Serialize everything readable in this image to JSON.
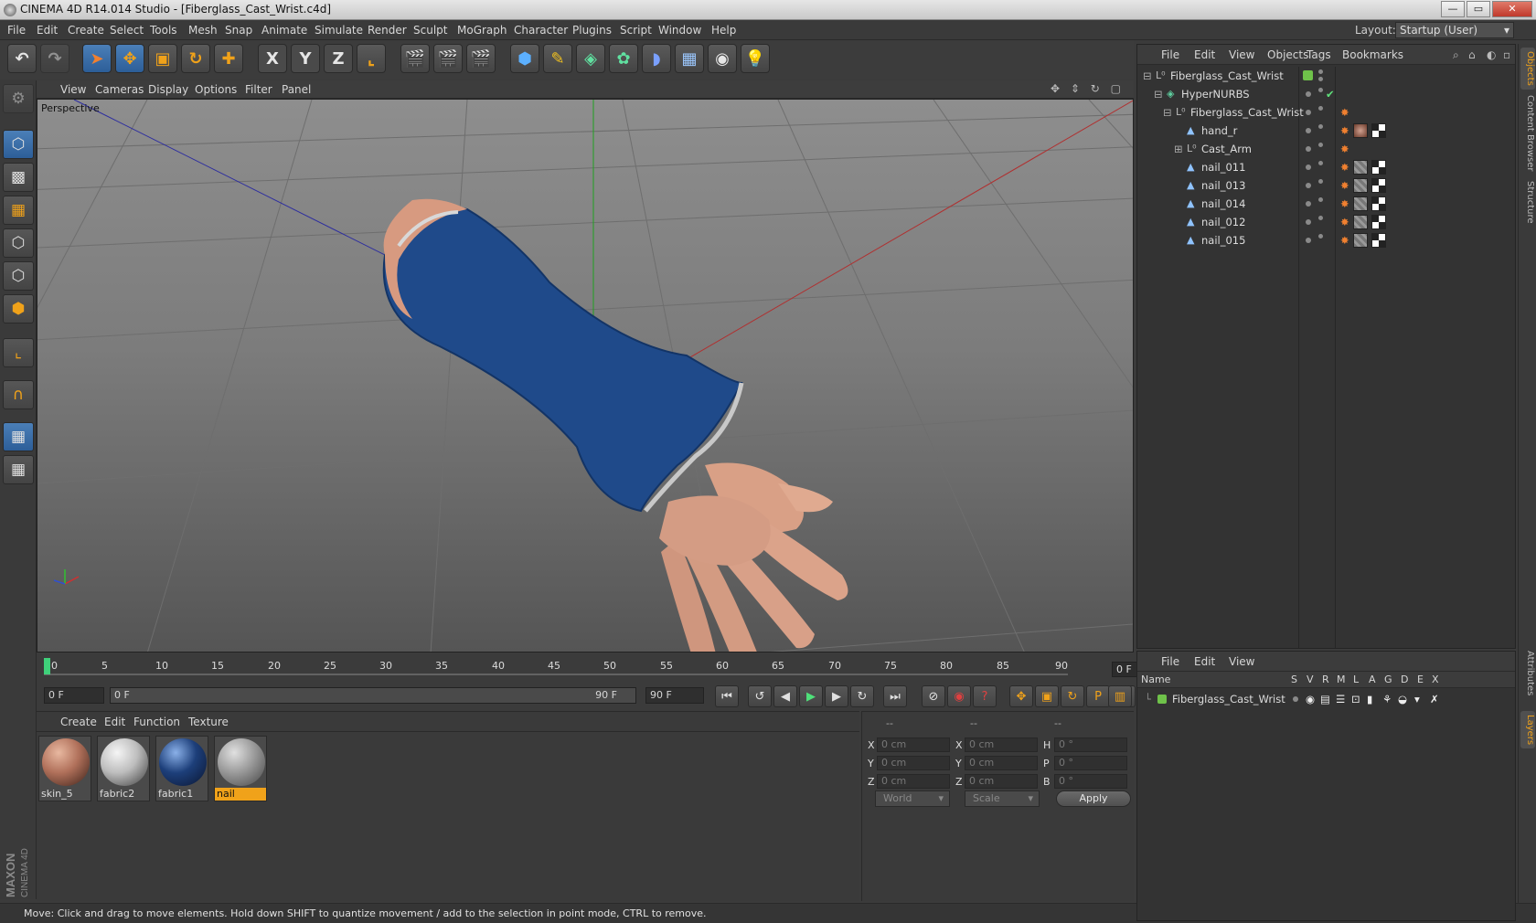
{
  "window": {
    "title": "CINEMA 4D R14.014 Studio - [Fiberglass_Cast_Wrist.c4d]",
    "min": "—",
    "max": "▭",
    "close": "✕"
  },
  "menu": [
    "File",
    "Edit",
    "Create",
    "Select",
    "Tools",
    "Mesh",
    "Snap",
    "Animate",
    "Simulate",
    "Render",
    "Sculpt",
    "MoGraph",
    "Character",
    "Plugins",
    "Script",
    "Window",
    "Help"
  ],
  "layout": {
    "label": "Layout:",
    "value": "Startup (User)"
  },
  "toolbar": {
    "x_axis": "X",
    "y_axis": "Y",
    "z_axis": "Z"
  },
  "viewport": {
    "menu": [
      "View",
      "Cameras",
      "Display",
      "Options",
      "Filter",
      "Panel"
    ],
    "label": "Perspective",
    "icons": "✥ ⇕ ↻ ▢"
  },
  "timeline": {
    "ticks": [
      "0",
      "5",
      "10",
      "15",
      "20",
      "25",
      "30",
      "35",
      "40",
      "45",
      "50",
      "55",
      "60",
      "65",
      "70",
      "75",
      "80",
      "85",
      "90"
    ],
    "current_frame": "0 F"
  },
  "transport": {
    "start_field": "0 F",
    "range_start": "0 F",
    "range_end": "90 F",
    "end_field": "90 F"
  },
  "materials": {
    "menu": [
      "Create",
      "Edit",
      "Function",
      "Texture"
    ],
    "items": [
      {
        "name": "skin_5",
        "color": "#b0705a"
      },
      {
        "name": "fabric2",
        "color": "#bdbdbd"
      },
      {
        "name": "fabric1",
        "color": "#1d3f7a"
      },
      {
        "name": "nail",
        "color": "#9a9a9a"
      }
    ],
    "selected": "nail"
  },
  "coords": {
    "headers": [
      "--",
      "--",
      "--"
    ],
    "rows": [
      {
        "a": "X",
        "av": "0 cm",
        "b": "X",
        "bv": "0 cm",
        "c": "H",
        "cv": "0 °"
      },
      {
        "a": "Y",
        "av": "0 cm",
        "b": "Y",
        "bv": "0 cm",
        "c": "P",
        "cv": "0 °"
      },
      {
        "a": "Z",
        "av": "0 cm",
        "b": "Z",
        "bv": "0 cm",
        "c": "B",
        "cv": "0 °"
      }
    ],
    "mode": "World",
    "scale": "Scale",
    "apply": "Apply"
  },
  "objects": {
    "menu": [
      "File",
      "Edit",
      "View",
      "Objects",
      "Tags",
      "Bookmarks"
    ],
    "tree": [
      {
        "name": "Fiberglass_Cast_Wrist",
        "indent": 0,
        "icon": "null"
      },
      {
        "name": "HyperNURBS",
        "indent": 1,
        "icon": "nurbs"
      },
      {
        "name": "Fiberglass_Cast_Wrist",
        "indent": 2,
        "icon": "null"
      },
      {
        "name": "hand_r",
        "indent": 3,
        "icon": "poly"
      },
      {
        "name": "Cast_Arm",
        "indent": 3,
        "icon": "null"
      },
      {
        "name": "nail_011",
        "indent": 3,
        "icon": "poly"
      },
      {
        "name": "nail_013",
        "indent": 3,
        "icon": "poly"
      },
      {
        "name": "nail_014",
        "indent": 3,
        "icon": "poly"
      },
      {
        "name": "nail_012",
        "indent": 3,
        "icon": "poly"
      },
      {
        "name": "nail_015",
        "indent": 3,
        "icon": "poly"
      }
    ]
  },
  "layers": {
    "menu": [
      "File",
      "Edit",
      "View"
    ],
    "columns": [
      "Name",
      "S",
      "V",
      "R",
      "M",
      "L",
      "A",
      "G",
      "D",
      "E",
      "X"
    ],
    "rows": [
      {
        "name": "Fiberglass_Cast_Wrist",
        "color": "#6fc24a"
      }
    ]
  },
  "side_tabs": [
    "Objects",
    "Content Browser",
    "Structure",
    "Attributes",
    "Layers"
  ],
  "brand": {
    "maxon": "MAXON",
    "product": "CINEMA 4D"
  },
  "status": "Move: Click and drag to move elements. Hold down SHIFT to quantize movement / add to the selection in point mode, CTRL to remove."
}
